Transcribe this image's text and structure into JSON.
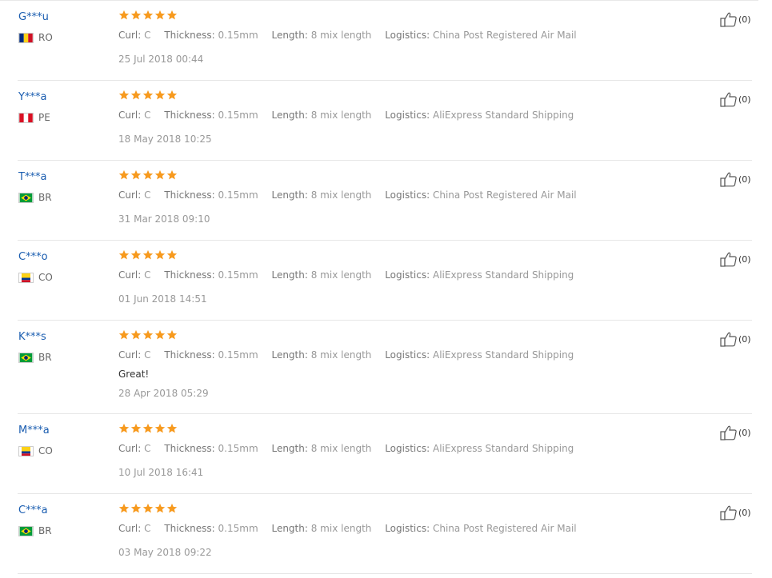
{
  "labels": {
    "curl": "Curl:",
    "thickness": "Thickness:",
    "length": "Length:",
    "logistics": "Logistics:"
  },
  "reviews": [
    {
      "user": "G***u",
      "country": "RO",
      "flag": "ro",
      "curl": "C",
      "thickness": "0.15mm",
      "length": "8 mix length",
      "logistics": "China Post Registered Air Mail",
      "comment": "",
      "date": "25 Jul 2018 00:44",
      "likes": "(0)"
    },
    {
      "user": "Y***a",
      "country": "PE",
      "flag": "pe",
      "curl": "C",
      "thickness": "0.15mm",
      "length": "8 mix length",
      "logistics": "AliExpress Standard Shipping",
      "comment": "",
      "date": "18 May 2018 10:25",
      "likes": "(0)"
    },
    {
      "user": "T***a",
      "country": "BR",
      "flag": "br",
      "curl": "C",
      "thickness": "0.15mm",
      "length": "8 mix length",
      "logistics": "China Post Registered Air Mail",
      "comment": "",
      "date": "31 Mar 2018 09:10",
      "likes": "(0)"
    },
    {
      "user": "C***o",
      "country": "CO",
      "flag": "co",
      "curl": "C",
      "thickness": "0.15mm",
      "length": "8 mix length",
      "logistics": "AliExpress Standard Shipping",
      "comment": "",
      "date": "01 Jun 2018 14:51",
      "likes": "(0)"
    },
    {
      "user": "K***s",
      "country": "BR",
      "flag": "br",
      "curl": "C",
      "thickness": "0.15mm",
      "length": "8 mix length",
      "logistics": "AliExpress Standard Shipping",
      "comment": "Great!",
      "date": "28 Apr 2018 05:29",
      "likes": "(0)"
    },
    {
      "user": "M***a",
      "country": "CO",
      "flag": "co",
      "curl": "C",
      "thickness": "0.15mm",
      "length": "8 mix length",
      "logistics": "AliExpress Standard Shipping",
      "comment": "",
      "date": "10 Jul 2018 16:41",
      "likes": "(0)"
    },
    {
      "user": "C***a",
      "country": "BR",
      "flag": "br",
      "curl": "C",
      "thickness": "0.15mm",
      "length": "8 mix length",
      "logistics": "China Post Registered Air Mail",
      "comment": "",
      "date": "03 May 2018 09:22",
      "likes": "(0)"
    }
  ],
  "rating_stars": 5,
  "colors": {
    "star": "#f79a1e",
    "username": "#1a5db0",
    "muted": "#999999"
  },
  "icons": {
    "like": "thumbs-up-icon",
    "star": "star-icon"
  }
}
